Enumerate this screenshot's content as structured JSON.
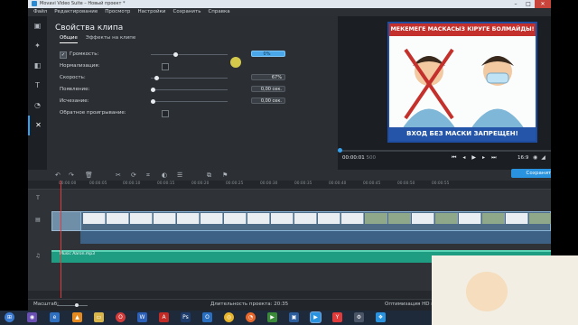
{
  "window": {
    "title": "Movavi Video Suite – Новый проект *"
  },
  "menu": [
    "Файл",
    "Редактирование",
    "Просмотр",
    "Настройки",
    "Сохранить",
    "Справка"
  ],
  "left_tools": [
    {
      "icon": "film-icon"
    },
    {
      "icon": "magic-wand-icon"
    },
    {
      "icon": "transitions-icon"
    },
    {
      "icon": "titles-icon"
    },
    {
      "icon": "filters-icon"
    },
    {
      "icon": "more-tools-icon"
    }
  ],
  "panel": {
    "title": "Свойства клипа",
    "tabs": [
      "Общие",
      "Эффекты на клипе"
    ],
    "props": [
      {
        "label": "Громкость:",
        "checkbox": true,
        "checked": true,
        "slider": 0.3,
        "value": "0%",
        "focused": true
      },
      {
        "label": "Нормализация:",
        "checkbox": false,
        "right_checkbox": true
      },
      {
        "label": "Скорость:",
        "checkbox": false,
        "slider": 0.05,
        "value": "67%"
      },
      {
        "label": "Появление:",
        "checkbox": false,
        "slider": 0.0,
        "value": "0,00 сек."
      },
      {
        "label": "Исчезание:",
        "checkbox": false,
        "slider": 0.0,
        "value": "0,00 сек."
      },
      {
        "label": "Обратное проигрывание:",
        "checkbox": false,
        "right_checkbox": true
      }
    ]
  },
  "preview": {
    "poster_top": "МЕКЕМЕГЕ МАСКАСЫЗ КІРУГЕ БОЛМАЙДЫ!",
    "poster_bottom": "ВХОД БЕЗ МАСКИ ЗАПРЕЩЕН!",
    "timecode": "00:00:01",
    "timecode_frames": "500",
    "aspect": "16:9",
    "progress": 0.0
  },
  "toolbar": {
    "save_label": "Сохранить"
  },
  "ruler": [
    "00:00:00",
    "00:00:05",
    "00:00:10",
    "00:00:15",
    "00:00:20",
    "00:00:25",
    "00:00:30",
    "00:00:35",
    "00:00:40",
    "00:00:45",
    "00:00:50",
    "00:00:55"
  ],
  "audio_clip_name": "Music Aaron.mp3",
  "status": {
    "zoom_label": "Масштаб:",
    "duration": "Длительность проекта: 20:35",
    "optimize": "Оптимизация HD клип"
  },
  "taskbar": [
    "windows-start-icon",
    "media-icon",
    "explorer-icon",
    "vlc-icon",
    "files-icon",
    "opera-icon",
    "word-icon",
    "acrobat-icon",
    "photoshop-icon",
    "outlook-icon",
    "chrome-icon",
    "firefox-icon",
    "media-player-icon",
    "video-icon",
    "movavi-icon",
    "yandex-icon",
    "settings-icon",
    "windows-icon"
  ],
  "colors": {
    "accent": "#2a93e0",
    "poster_red": "#c4302b",
    "poster_blue": "#2455a8",
    "audio": "#1f9d82"
  }
}
